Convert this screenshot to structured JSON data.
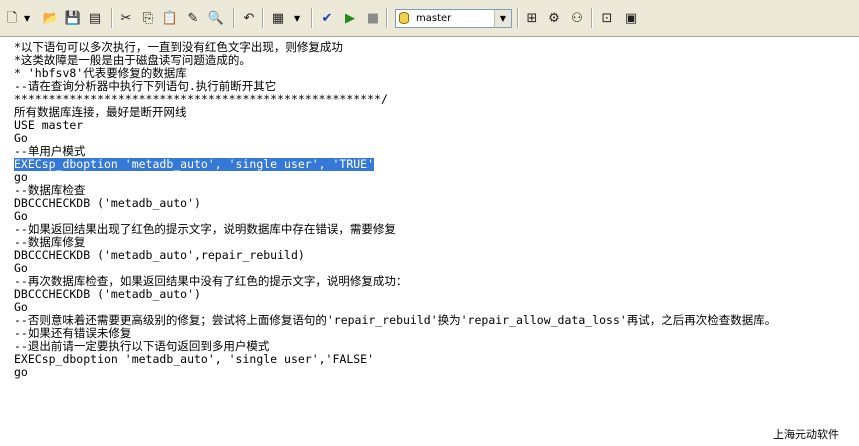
{
  "toolbar": {
    "database": "master",
    "buttons": [
      {
        "name": "new-query-icon",
        "glyph": "🗋"
      },
      {
        "name": "open-icon",
        "glyph": "📂"
      },
      {
        "name": "save-icon",
        "glyph": "💾"
      },
      {
        "name": "load-script-icon",
        "glyph": "▤"
      },
      {
        "name": "cut-icon",
        "glyph": "✂"
      },
      {
        "name": "copy-icon",
        "glyph": "⎘"
      },
      {
        "name": "paste-icon",
        "glyph": "📋"
      },
      {
        "name": "clear-icon",
        "glyph": "✎"
      },
      {
        "name": "find-icon",
        "glyph": "🔍"
      },
      {
        "name": "undo-icon",
        "glyph": "↶"
      },
      {
        "name": "results-mode-icon",
        "glyph": "▦"
      },
      {
        "name": "parse-icon",
        "glyph": "✔"
      },
      {
        "name": "execute-icon",
        "glyph": "▶"
      },
      {
        "name": "stop-icon",
        "glyph": "■"
      },
      {
        "name": "object-browser-icon",
        "glyph": "⊞"
      },
      {
        "name": "object-search-icon",
        "glyph": "⚙"
      },
      {
        "name": "current-connection-icon",
        "glyph": "⚇"
      },
      {
        "name": "properties-icon",
        "glyph": "⊡"
      },
      {
        "name": "show-results-icon",
        "glyph": "▣"
      }
    ],
    "colors": {
      "parse": "#1a3fb8",
      "execute": "#1c8c1c",
      "stop": "#8c8c8c"
    }
  },
  "editor": {
    "lines": [
      "*以下语句可以多次执行，一直到没有红色文字出现，则修复成功",
      "*这类故障是一般是由于磁盘读写问题造成的。",
      "* 'hbfsv8'代表要修复的数据库",
      "--请在查询分析器中执行下列语句.执行前断开其它",
      "*****************************************************/",
      "所有数据库连接，最好是断开网线",
      "USE master",
      "Go",
      "--单用户模式",
      "EXECsp_dboption 'metadb_auto', 'single user', 'TRUE'",
      "go",
      "--数据库检查",
      "DBCCCHECKDB ('metadb_auto')",
      "Go",
      "--如果返回结果出现了红色的提示文字，说明数据库中存在错误，需要修复",
      "--数据库修复",
      "DBCCCHECKDB ('metadb_auto',repair_rebuild)",
      "Go",
      "--再次数据库检查，如果返回结果中没有了红色的提示文字，说明修复成功：",
      "DBCCCHECKDB ('metadb_auto')",
      "Go",
      "--否则意味着还需要更高级别的修复；尝试将上面修复语句的'repair_rebuild'换为'repair_allow_data_loss'再试，之后再次检查数据库。",
      "--如果还有错误未修复",
      "--退出前请一定要执行以下语句返回到多用户模式",
      "EXECsp_dboption 'metadb_auto', 'single user','FALSE'",
      "go"
    ],
    "selected_line": 9,
    "selection_color": "#3478d8"
  },
  "watermark": "上海元动软件"
}
